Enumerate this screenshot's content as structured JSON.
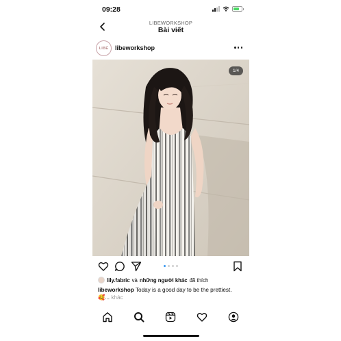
{
  "status_bar": {
    "time": "09:28"
  },
  "header": {
    "account": "LIBEWORKSHOP",
    "title": "Bài viết"
  },
  "post": {
    "avatar_text": "LIBÉ",
    "username": "libeworkshop",
    "page_indicator": "1/4",
    "carousel": {
      "count": 4,
      "active_index": 0
    }
  },
  "likes": {
    "user": "lily.fabric",
    "connector": "và",
    "others": "những người khác",
    "suffix": "đã thích"
  },
  "caption": {
    "username": "libeworkshop",
    "text": "Today is a good day to be the prettiest. 🥰...",
    "more": "khác"
  },
  "icons": {
    "back": "chevron-left-icon",
    "more": "more-dots-icon",
    "like": "heart-icon",
    "comment": "comment-icon",
    "share": "send-icon",
    "save": "bookmark-icon",
    "home": "home-icon",
    "search": "search-icon",
    "reels": "reels-icon",
    "activity": "heart-icon",
    "profile": "profile-icon"
  },
  "colors": {
    "accent": "#3897f0",
    "text": "#111111",
    "muted": "#999999"
  }
}
